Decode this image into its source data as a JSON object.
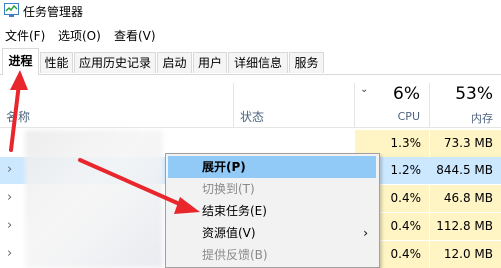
{
  "window": {
    "title": "任务管理器"
  },
  "menu": [
    {
      "label": "文件(F)"
    },
    {
      "label": "选项(O)"
    },
    {
      "label": "查看(V)"
    }
  ],
  "tabs": [
    {
      "label": "进程",
      "active": true
    },
    {
      "label": "性能"
    },
    {
      "label": "应用历史记录"
    },
    {
      "label": "启动"
    },
    {
      "label": "用户"
    },
    {
      "label": "详细信息"
    },
    {
      "label": "服务"
    }
  ],
  "header": {
    "name": "名称",
    "status": "状态",
    "cpu_pct": "6%",
    "cpu_label": "CPU",
    "mem_pct": "53%",
    "mem_label": "内存"
  },
  "rows": [
    {
      "cpu": "1.3%",
      "mem": "73.3 MB"
    },
    {
      "cpu": "1.2%",
      "mem": "844.5 MB",
      "selected": true
    },
    {
      "cpu": "0.4%",
      "mem": "46.8 MB"
    },
    {
      "cpu": "0.4%",
      "mem": "112.8 MB"
    },
    {
      "cpu": "0.4%",
      "mem": "12.0 MB"
    }
  ],
  "context_menu": [
    {
      "label": "展开(P)",
      "highlighted": true
    },
    {
      "label": "切换到(T)",
      "disabled": true
    },
    {
      "label": "结束任务(E)"
    },
    {
      "label": "资源值(V)",
      "submenu": true
    },
    {
      "label": "提供反馈(B)",
      "disabled": true
    }
  ],
  "colors": {
    "accent_arrow": "#e8262c",
    "heat_cell": "#fff4c4",
    "selected_row": "#cce8ff",
    "menu_highlight": "#91c9f7"
  },
  "icons": {
    "app": "task-manager-icon",
    "expander": "chevron-right-icon",
    "sort": "chevron-down-icon",
    "submenu": "chevron-right-icon"
  }
}
